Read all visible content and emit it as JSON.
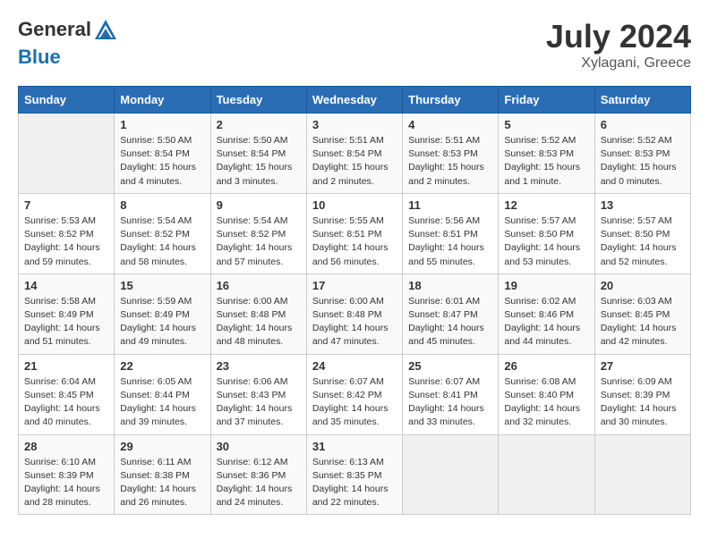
{
  "header": {
    "logo_general": "General",
    "logo_blue": "Blue",
    "month_year": "July 2024",
    "location": "Xylagani, Greece"
  },
  "days_of_week": [
    "Sunday",
    "Monday",
    "Tuesday",
    "Wednesday",
    "Thursday",
    "Friday",
    "Saturday"
  ],
  "weeks": [
    [
      {
        "day": "",
        "sunrise": "",
        "sunset": "",
        "daylight": "",
        "empty": true
      },
      {
        "day": "1",
        "sunrise": "Sunrise: 5:50 AM",
        "sunset": "Sunset: 8:54 PM",
        "daylight": "Daylight: 15 hours and 4 minutes."
      },
      {
        "day": "2",
        "sunrise": "Sunrise: 5:50 AM",
        "sunset": "Sunset: 8:54 PM",
        "daylight": "Daylight: 15 hours and 3 minutes."
      },
      {
        "day": "3",
        "sunrise": "Sunrise: 5:51 AM",
        "sunset": "Sunset: 8:54 PM",
        "daylight": "Daylight: 15 hours and 2 minutes."
      },
      {
        "day": "4",
        "sunrise": "Sunrise: 5:51 AM",
        "sunset": "Sunset: 8:53 PM",
        "daylight": "Daylight: 15 hours and 2 minutes."
      },
      {
        "day": "5",
        "sunrise": "Sunrise: 5:52 AM",
        "sunset": "Sunset: 8:53 PM",
        "daylight": "Daylight: 15 hours and 1 minute."
      },
      {
        "day": "6",
        "sunrise": "Sunrise: 5:52 AM",
        "sunset": "Sunset: 8:53 PM",
        "daylight": "Daylight: 15 hours and 0 minutes."
      }
    ],
    [
      {
        "day": "7",
        "sunrise": "Sunrise: 5:53 AM",
        "sunset": "Sunset: 8:52 PM",
        "daylight": "Daylight: 14 hours and 59 minutes."
      },
      {
        "day": "8",
        "sunrise": "Sunrise: 5:54 AM",
        "sunset": "Sunset: 8:52 PM",
        "daylight": "Daylight: 14 hours and 58 minutes."
      },
      {
        "day": "9",
        "sunrise": "Sunrise: 5:54 AM",
        "sunset": "Sunset: 8:52 PM",
        "daylight": "Daylight: 14 hours and 57 minutes."
      },
      {
        "day": "10",
        "sunrise": "Sunrise: 5:55 AM",
        "sunset": "Sunset: 8:51 PM",
        "daylight": "Daylight: 14 hours and 56 minutes."
      },
      {
        "day": "11",
        "sunrise": "Sunrise: 5:56 AM",
        "sunset": "Sunset: 8:51 PM",
        "daylight": "Daylight: 14 hours and 55 minutes."
      },
      {
        "day": "12",
        "sunrise": "Sunrise: 5:57 AM",
        "sunset": "Sunset: 8:50 PM",
        "daylight": "Daylight: 14 hours and 53 minutes."
      },
      {
        "day": "13",
        "sunrise": "Sunrise: 5:57 AM",
        "sunset": "Sunset: 8:50 PM",
        "daylight": "Daylight: 14 hours and 52 minutes."
      }
    ],
    [
      {
        "day": "14",
        "sunrise": "Sunrise: 5:58 AM",
        "sunset": "Sunset: 8:49 PM",
        "daylight": "Daylight: 14 hours and 51 minutes."
      },
      {
        "day": "15",
        "sunrise": "Sunrise: 5:59 AM",
        "sunset": "Sunset: 8:49 PM",
        "daylight": "Daylight: 14 hours and 49 minutes."
      },
      {
        "day": "16",
        "sunrise": "Sunrise: 6:00 AM",
        "sunset": "Sunset: 8:48 PM",
        "daylight": "Daylight: 14 hours and 48 minutes."
      },
      {
        "day": "17",
        "sunrise": "Sunrise: 6:00 AM",
        "sunset": "Sunset: 8:48 PM",
        "daylight": "Daylight: 14 hours and 47 minutes."
      },
      {
        "day": "18",
        "sunrise": "Sunrise: 6:01 AM",
        "sunset": "Sunset: 8:47 PM",
        "daylight": "Daylight: 14 hours and 45 minutes."
      },
      {
        "day": "19",
        "sunrise": "Sunrise: 6:02 AM",
        "sunset": "Sunset: 8:46 PM",
        "daylight": "Daylight: 14 hours and 44 minutes."
      },
      {
        "day": "20",
        "sunrise": "Sunrise: 6:03 AM",
        "sunset": "Sunset: 8:45 PM",
        "daylight": "Daylight: 14 hours and 42 minutes."
      }
    ],
    [
      {
        "day": "21",
        "sunrise": "Sunrise: 6:04 AM",
        "sunset": "Sunset: 8:45 PM",
        "daylight": "Daylight: 14 hours and 40 minutes."
      },
      {
        "day": "22",
        "sunrise": "Sunrise: 6:05 AM",
        "sunset": "Sunset: 8:44 PM",
        "daylight": "Daylight: 14 hours and 39 minutes."
      },
      {
        "day": "23",
        "sunrise": "Sunrise: 6:06 AM",
        "sunset": "Sunset: 8:43 PM",
        "daylight": "Daylight: 14 hours and 37 minutes."
      },
      {
        "day": "24",
        "sunrise": "Sunrise: 6:07 AM",
        "sunset": "Sunset: 8:42 PM",
        "daylight": "Daylight: 14 hours and 35 minutes."
      },
      {
        "day": "25",
        "sunrise": "Sunrise: 6:07 AM",
        "sunset": "Sunset: 8:41 PM",
        "daylight": "Daylight: 14 hours and 33 minutes."
      },
      {
        "day": "26",
        "sunrise": "Sunrise: 6:08 AM",
        "sunset": "Sunset: 8:40 PM",
        "daylight": "Daylight: 14 hours and 32 minutes."
      },
      {
        "day": "27",
        "sunrise": "Sunrise: 6:09 AM",
        "sunset": "Sunset: 8:39 PM",
        "daylight": "Daylight: 14 hours and 30 minutes."
      }
    ],
    [
      {
        "day": "28",
        "sunrise": "Sunrise: 6:10 AM",
        "sunset": "Sunset: 8:39 PM",
        "daylight": "Daylight: 14 hours and 28 minutes."
      },
      {
        "day": "29",
        "sunrise": "Sunrise: 6:11 AM",
        "sunset": "Sunset: 8:38 PM",
        "daylight": "Daylight: 14 hours and 26 minutes."
      },
      {
        "day": "30",
        "sunrise": "Sunrise: 6:12 AM",
        "sunset": "Sunset: 8:36 PM",
        "daylight": "Daylight: 14 hours and 24 minutes."
      },
      {
        "day": "31",
        "sunrise": "Sunrise: 6:13 AM",
        "sunset": "Sunset: 8:35 PM",
        "daylight": "Daylight: 14 hours and 22 minutes."
      },
      {
        "day": "",
        "sunrise": "",
        "sunset": "",
        "daylight": "",
        "empty": true
      },
      {
        "day": "",
        "sunrise": "",
        "sunset": "",
        "daylight": "",
        "empty": true
      },
      {
        "day": "",
        "sunrise": "",
        "sunset": "",
        "daylight": "",
        "empty": true
      }
    ]
  ]
}
